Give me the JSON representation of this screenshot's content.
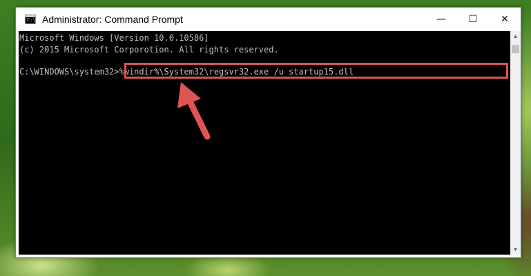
{
  "window": {
    "title": "Administrator: Command Prompt",
    "icon": "cmd-icon",
    "controls": {
      "minimize": "—",
      "maximize": "☐",
      "close": "✕"
    }
  },
  "console": {
    "lines": [
      "Microsoft Windows [Version 10.0.10586]",
      "(c) 2015 Microsoft Corporotion. All rights reserved."
    ],
    "prompt": "C:\\WINDOWS\\system32>",
    "command": "%windir%\\System32\\regsvr32.exe /u startup15.dll"
  },
  "scrollbar": {
    "up": "▲",
    "down": "▼"
  },
  "annotation": {
    "highlight_color": "#e05454",
    "arrow_color": "#e05454"
  }
}
